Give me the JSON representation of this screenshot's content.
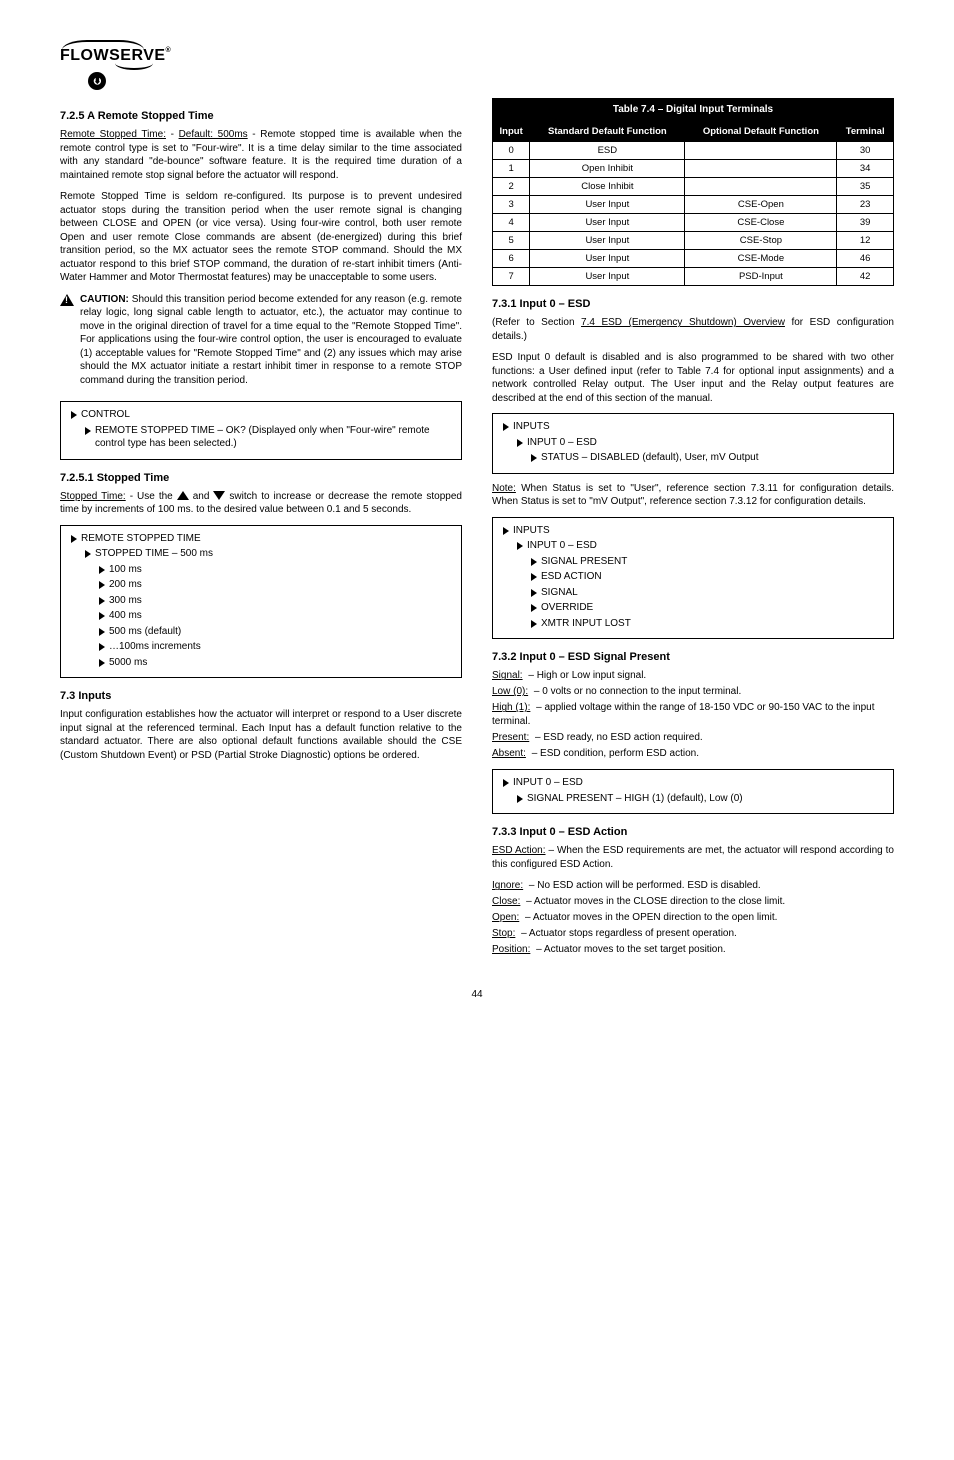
{
  "logo": {
    "name": "FLOWSERVE",
    "reg": "®"
  },
  "left": {
    "sec_7_2_5": "7.2.5  A Remote Stopped Time",
    "para1_a": "Remote Stopped Time:",
    "para1_b": " - ",
    "para1_c": "Default: 500ms",
    "para1_d": " - Remote stopped time is available when the remote control type is set to \"Four-wire\".  It is a time delay similar to the time associated with any standard \"de-bounce\" software feature.  It is the required time duration of a maintained remote stop signal before the actuator will respond.",
    "para2": "Remote Stopped Time is seldom re-configured.  Its purpose is to prevent undesired actuator stops during the transition period when the user remote signal is changing between CLOSE and OPEN (or vice versa).  Using four-wire control, both user remote Open and user remote Close commands are absent (de-energized) during this brief transition period, so the MX actuator sees the remote STOP command.  Should the MX actuator respond to this brief STOP command, the duration of re-start inhibit timers (Anti-Water Hammer and Motor Thermostat features) may be unacceptable to some users.",
    "caution_label": "CAUTION:",
    "caution_text": " Should this transition period become extended for any reason (e.g. remote relay logic, long signal cable length to actuator, etc.), the actuator may continue to move in the original direction of travel for a time equal to the \"Remote Stopped Time\".  For applications using the four-wire control option, the user is encouraged to evaluate (1) acceptable values for \"Remote Stopped Time\" and (2) any issues which may arise should the MX actuator initiate a restart inhibit timer in response to a remote STOP command during the transition period.",
    "menu1": {
      "r1": "CONTROL",
      "r2": "REMOTE STOPPED TIME – OK? (Displayed only when \"Four-wire\" remote control type has been selected.)"
    },
    "sec_7_2_5_1": "7.2.5.1  Stopped Time",
    "stopped_para_a": "Stopped Time:",
    "stopped_para_b": " - Use the ",
    "stopped_para_c": " and ",
    "stopped_para_d": " switch to increase or decrease the remote stopped time by increments of 100 ms. to the desired value between 0.1 and 5 seconds.",
    "menu2": {
      "top": "REMOTE STOPPED TIME",
      "sub": "STOPPED TIME – 500 ms",
      "opts": [
        "100 ms",
        "200 ms",
        "300 ms",
        "400 ms",
        "500 ms (default)",
        "…100ms increments",
        "5000 ms"
      ]
    }
  },
  "right": {
    "table": {
      "title": "Table 7.4 – Digital Input Terminals",
      "headers": [
        "Input",
        "Standard Default Function",
        "Optional Default Function",
        "Terminal"
      ],
      "rows": [
        [
          "0",
          "ESD",
          "",
          "30"
        ],
        [
          "1",
          "Open Inhibit",
          "",
          "34"
        ],
        [
          "2",
          "Close Inhibit",
          "",
          "35"
        ],
        [
          "3",
          "User Input",
          "CSE-Open",
          "23"
        ],
        [
          "4",
          "User Input",
          "CSE-Close",
          "39"
        ],
        [
          "5",
          "User Input",
          "CSE-Stop",
          "12"
        ],
        [
          "6",
          "User Input",
          "CSE-Mode",
          "46"
        ],
        [
          "7",
          "User Input",
          "PSD-Input",
          "42"
        ]
      ]
    },
    "sec_7_3_1": "7.3.1  Input 0 – ESD",
    "esd_ref_a": "(Refer to Section ",
    "esd_ref_b": "7.4  ESD (Emergency Shutdown) Overview",
    "esd_ref_c": " for ESD configuration details.)",
    "esd_para": "ESD Input 0 default is disabled and is also programmed to be shared with two other functions: a User defined input (refer to Table 7.4 for optional input assignments) and a network controlled Relay output. The User input and the Relay output features are described at the end of this section of the manual.",
    "menu_esd": {
      "top": "INPUTS",
      "l1": "INPUT 0 – ESD",
      "l2": "STATUS – DISABLED (default), User, mV Output"
    },
    "note_label": "Note:",
    "note_text": " When Status is set to \"User\", reference section 7.3.11 for configuration details. When Status is set to \"mV Output\", reference section 7.3.12 for configuration details.",
    "menu_esd2": {
      "top": "INPUTS",
      "l1": "INPUT 0 – ESD",
      "items": [
        "SIGNAL PRESENT",
        "ESD ACTION",
        "SIGNAL",
        "OVERRIDE",
        "XMTR INPUT LOST"
      ]
    },
    "sec_7_3_2": "7.3.2  Input 0 – ESD Signal Present",
    "sp_defs": [
      [
        "Signal:",
        " – High or Low input signal."
      ],
      [
        "Low (0):",
        " – 0 volts or no connection to the input terminal."
      ],
      [
        "High (1):",
        " – applied voltage within the range of 18-150 VDC or 90-150 VAC to the input terminal."
      ],
      [
        "Present:",
        " – ESD ready, no ESD action required."
      ],
      [
        "Absent:",
        " – ESD condition, perform ESD action."
      ]
    ],
    "menu_sp": {
      "top": "INPUT 0 – ESD",
      "l1": "SIGNAL PRESENT – HIGH (1) (default), Low (0)"
    },
    "sec_7_3_3": "7.3.3  Input 0 – ESD Action",
    "esd_action_a": "ESD Action:",
    "esd_action_b": " – When the ESD requirements are met, the actuator will respond according to this configured ESD Action.",
    "esd_action_defs": [
      [
        "Ignore:",
        " – No ESD action will be performed. ESD is disabled."
      ],
      [
        "Close:",
        " – Actuator moves in the CLOSE direction to the close limit."
      ],
      [
        "Open:",
        " – Actuator moves in the OPEN direction to the open limit."
      ],
      [
        "Stop:",
        " – Actuator stops regardless of present operation."
      ],
      [
        "Position:",
        " – Actuator moves to the set target position."
      ]
    ]
  },
  "sec_7_3_heading": "7.3  Inputs",
  "sec_7_3_para": "Input configuration establishes how the actuator will interpret or respond to a User discrete input signal at the referenced terminal.  Each Input has a default function relative to the standard actuator.  There are also optional default functions available should the CSE (Custom Shutdown Event) or PSD (Partial Stroke Diagnostic) options be ordered.",
  "page_number": "44"
}
